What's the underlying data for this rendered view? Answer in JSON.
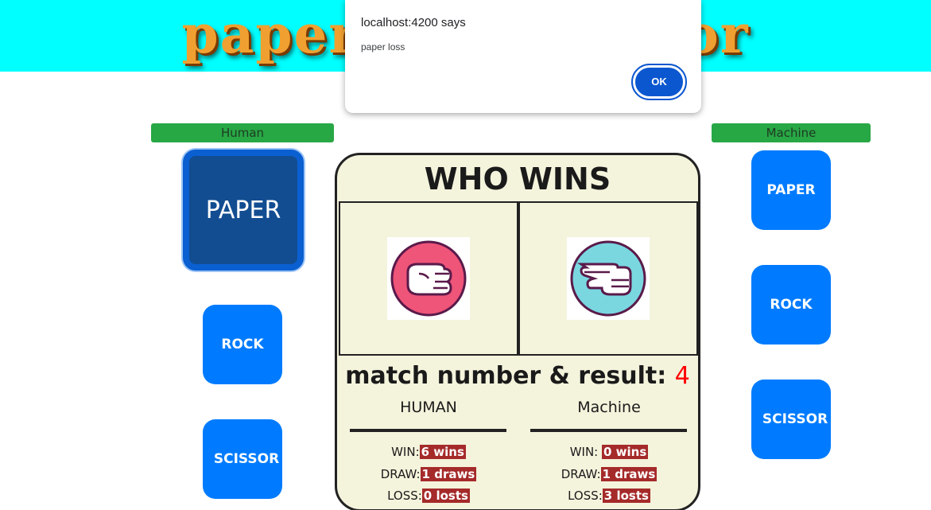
{
  "banner": {
    "title": "paper rock scissor"
  },
  "human": {
    "label": "Human",
    "buttons": [
      {
        "label": "PAPER",
        "selected": true
      },
      {
        "label": "ROCK",
        "selected": false
      },
      {
        "label": "SCISSOR",
        "selected": false
      }
    ]
  },
  "machine": {
    "label": "Machine",
    "buttons": [
      {
        "label": "PAPER"
      },
      {
        "label": "ROCK"
      },
      {
        "label": "SCISSOR"
      }
    ]
  },
  "board": {
    "title": "WHO WINS",
    "human_hand_icon": "rock-hand-icon",
    "machine_hand_icon": "scissor-hand-icon",
    "match_label": "match number & result: ",
    "match_number": "4",
    "human": {
      "heading": "HUMAN",
      "win_label": "WIN:",
      "win_value": "6 wins",
      "draw_label": "DRAW:",
      "draw_value": "1 draws",
      "loss_label": "LOSS:",
      "loss_value": "0 losts"
    },
    "machine": {
      "heading": "Machine",
      "win_label": "WIN: ",
      "win_value": "0 wins",
      "draw_label": "DRAW:",
      "draw_value": "1 draws",
      "loss_label": "LOSS:",
      "loss_value": "3 losts"
    }
  },
  "dialog": {
    "title": "localhost:4200 says",
    "message": "paper loss",
    "ok_label": "OK"
  },
  "colors": {
    "banner": "#00ffff",
    "label_bg": "#28a745",
    "button": "#007bff",
    "selected_button": "#124d91",
    "stat_bg": "#a52a2a",
    "match_number": "#ff0000",
    "dialog_ok": "#0b57d0"
  }
}
